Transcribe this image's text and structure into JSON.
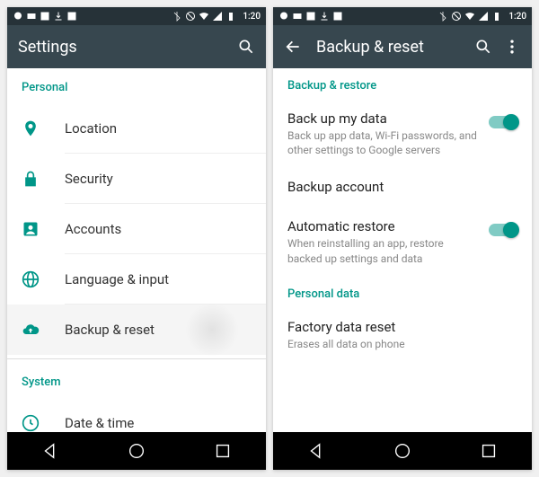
{
  "status": {
    "time": "1:20"
  },
  "left": {
    "title": "Settings",
    "section_personal": "Personal",
    "items": [
      {
        "label": "Location"
      },
      {
        "label": "Security"
      },
      {
        "label": "Accounts"
      },
      {
        "label": "Language & input"
      },
      {
        "label": "Backup & reset"
      }
    ],
    "section_system": "System",
    "system_items": [
      {
        "label": "Date & time"
      }
    ]
  },
  "right": {
    "title": "Backup & reset",
    "section_backup": "Backup & restore",
    "backup_data": {
      "title": "Back up my data",
      "sub": "Back up app data, Wi-Fi passwords, and other settings to Google servers"
    },
    "backup_account": {
      "title": "Backup account"
    },
    "auto_restore": {
      "title": "Automatic restore",
      "sub": "When reinstalling an app, restore backed up settings and data"
    },
    "section_personal": "Personal data",
    "factory": {
      "title": "Factory data reset",
      "sub": "Erases all data on phone"
    }
  },
  "chart_data": {
    "type": "table",
    "note": "UI screenshot, no chart"
  }
}
